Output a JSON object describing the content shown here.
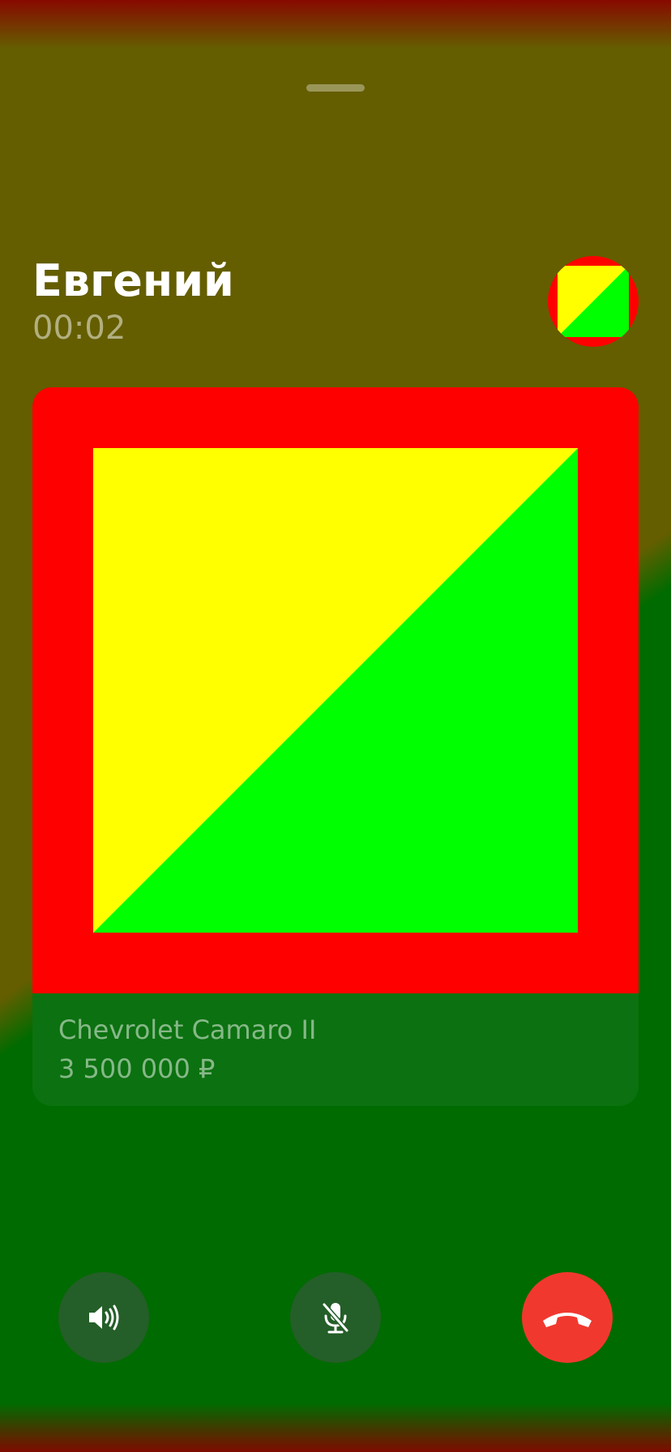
{
  "call": {
    "caller_name": "Евгений",
    "duration": "00:02"
  },
  "listing": {
    "title": "Chevrolet Camaro II",
    "price": "3 500 000 ₽"
  },
  "controls": [
    {
      "name": "speaker",
      "icon": "speaker-icon"
    },
    {
      "name": "mute",
      "icon": "mic-off-icon"
    },
    {
      "name": "hang-up",
      "icon": "phone-hangup-icon"
    }
  ],
  "colors": {
    "background_top": "#645e00",
    "background_bottom": "#006b00",
    "hangup": "#f1382f",
    "control_bg": "#245e28",
    "placeholder_frame": "#ff0000",
    "placeholder_a": "#ffff00",
    "placeholder_b": "#00ff00"
  }
}
